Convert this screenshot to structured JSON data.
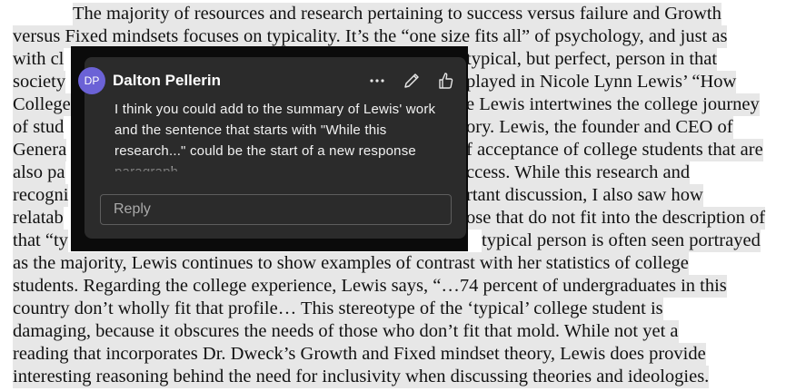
{
  "document": {
    "lines": [
      {
        "id": "l1",
        "segments": [
          "The majority of resources and research pertaining to success versus failure and Growth"
        ]
      },
      {
        "id": "l2",
        "segments": [
          "versus Fixed mindsets focuses on typicality. It’s the “one size fits all” of psychology, and just as"
        ]
      },
      {
        "id": "l3",
        "segments": [
          "with cl",
          "typical, but perfect, person in that"
        ]
      },
      {
        "id": "l4",
        "segments": [
          "society",
          "played in Nicole Lynn Lewis’ “How"
        ]
      },
      {
        "id": "l5",
        "segments": [
          "College",
          "e Lewis intertwines the college journey"
        ]
      },
      {
        "id": "l6",
        "segments": [
          "of stud",
          "ory. Lewis, the founder and CEO of"
        ]
      },
      {
        "id": "l7",
        "segments": [
          "Genera",
          "f acceptance of college students that are"
        ]
      },
      {
        "id": "l8",
        "segments": [
          "also pa",
          "ccess. While this research and"
        ]
      },
      {
        "id": "l9",
        "segments": [
          "recogni",
          "rtant discussion, I also saw how"
        ]
      },
      {
        "id": "l10",
        "segments": [
          "relatab",
          "ose that do not fit into the description of"
        ]
      },
      {
        "id": "l11",
        "segments": [
          "that “ty",
          "typical person is often seen portrayed"
        ]
      },
      {
        "id": "l12",
        "segments": [
          "as the majority, Lewis continues to show examples of contrast with her statistics of college"
        ]
      },
      {
        "id": "l13",
        "segments": [
          "students. Regarding the college experience, Lewis says, “…74 percent of undergraduates in this"
        ]
      },
      {
        "id": "l14",
        "segments": [
          "country don’t wholly fit that profile… This stereotype of the ‘typical’ college student is"
        ]
      },
      {
        "id": "l15",
        "segments": [
          "damaging, because it obscures the needs of those who don’t fit that mold. While not yet a"
        ]
      },
      {
        "id": "l16",
        "segments": [
          "reading that incorporates Dr. Dweck’s Growth and Fixed mindset theory, Lewis does provide"
        ]
      },
      {
        "id": "l17",
        "segments": [
          "interesting reasoning behind the need for inclusivity when discussing theories and ideologies."
        ]
      }
    ]
  },
  "comment": {
    "avatar_initials": "DP",
    "author": "Dalton Pellerin",
    "text": "I think you could add to the summary of Lewis' work and the sentence that starts with \"While this research...\" could be the start of a new response paragraph.",
    "reply_placeholder": "Reply",
    "actions": [
      {
        "name": "more-options",
        "icon": "more-horizontal-icon"
      },
      {
        "name": "edit",
        "icon": "pencil-icon"
      },
      {
        "name": "like",
        "icon": "thumbs-up-icon"
      }
    ],
    "colors": {
      "avatar": "#6b62d6",
      "card": "#2b2b2b",
      "backdrop": "#0b0b0b"
    }
  }
}
